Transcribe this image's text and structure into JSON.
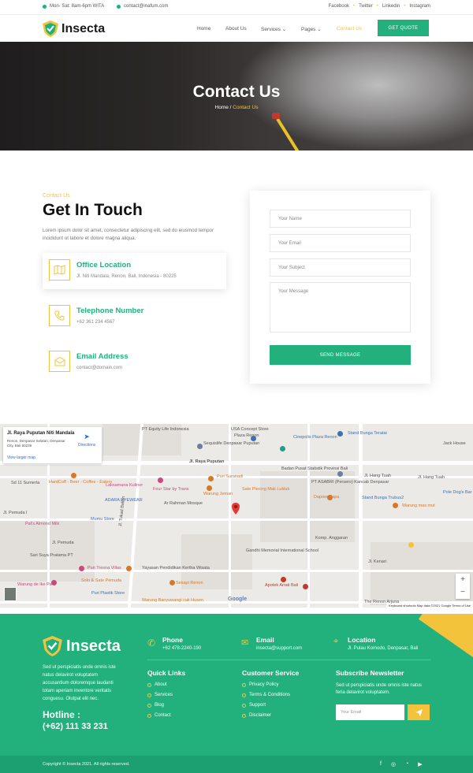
{
  "topbar": {
    "hours": "Mon- Sat: 8am-6pm WITA",
    "email": "contact@inafum.com",
    "social": [
      "Facebook",
      "Twitter",
      "Linkedin",
      "Instagram"
    ]
  },
  "nav": {
    "brand": "Insecta",
    "items": [
      "Home",
      "About Us",
      "Services",
      "Pages",
      "Contact Us"
    ],
    "cta": "GET QUOTE"
  },
  "hero": {
    "title": "Contact Us",
    "crumb_home": "Home /",
    "crumb_current": "Contact Us"
  },
  "contact": {
    "subtitle": "Contact Us",
    "title": "Get In Touch",
    "lead": "Lorem ipsum dolor sit amet, consectetur adipiscing elit, sed do eiusmod tempor incididunt ut labore et dolore magna aliqua.",
    "cards": [
      {
        "title": "Office Location",
        "text": "Jl. Niti Mandala, Renon, Bali, Indonesia - 80225"
      },
      {
        "title": "Telephone Number",
        "text": "+62 361 234 4567"
      },
      {
        "title": "Email Address",
        "text": "contact@domain.com"
      }
    ]
  },
  "form": {
    "name_placeholder": "Your Name",
    "email_placeholder": "Your Email",
    "subject_placeholder": "Your Subject",
    "message_placeholder": "Your Message",
    "submit": "SEND MESSAGE"
  },
  "map": {
    "place_title": "Jl. Raya Puputan Niti Mandala",
    "place_address": "Renon, Denpasar Selatan, Denpasar City, Bali 80239",
    "larger_map": "View larger map",
    "directions": "Directions",
    "labels": [
      "PT Equity Life Indonesia",
      "USA Concept Store",
      "Plaza Renon",
      "Cinepolis Plaza Renon",
      "Stand Bunga Teratai",
      "Jack House",
      "Sequislife Denpasar Puputan",
      "Jl. Raya Puputan",
      "Badan Pusat Statistik Provinsi Bali",
      "Jl. Hang Tuah",
      "Jl. Hang Tuah",
      "PT ASABRI (Persero) Kancab Denpasar",
      "Dapoer Papa",
      "Stand Bunga Trubus2",
      "Warung mas mut",
      "Pole Dog's Bar",
      "HardCoff - Beer - Coffee - Eatery",
      "Laksamana Kuliner",
      "Four Star by Trans",
      "Puri Suranadi",
      "Sate Plecing Mak Lukluk",
      "Warung Jeman",
      "ADARA EYEWEAR",
      "Ar Rahman Mosque",
      "Mumu Store",
      "Pat's Almond Milk",
      "Jl. Pemuda I",
      "Jl. Pemuda",
      "Sari Suya Pratama PT",
      "Puri Tresna Villas",
      "Warung de Ike Pa",
      "Solo & Sate Pemuda",
      "Puri Plastik Store",
      "Yayasan Pendidikan Kertha Wisata",
      "Sekapi Renon",
      "Gandhi Memorial International School",
      "Apotek Arrati Bali",
      "The Renon Arjuna",
      "Warung Banyuwangi cak Husen",
      "Jl. Tukad Balian",
      "Jl. Kenari",
      "Komp. Anggaran",
      "Sd 11 Sumerta"
    ],
    "footer_text": "Keyboard shortcuts   Map data ©2021 Google   Terms of Use",
    "google": "Google"
  },
  "footer": {
    "brand": "Insecta",
    "desc": "Sed ut perspiciatis unde omnis iste natus delavirot voluptatem accusantium doloremque laudanti totam aperiam inventore veritatis conguesu. Olutpat elit nec.",
    "hotline_label": "Hotline :",
    "hotline": "(+62) 111 33 231",
    "phone_title": "Phone",
    "phone": "+62 478-2240-190",
    "email_title": "Email",
    "email": "insecta@support.com",
    "location_title": "Location",
    "location": "Jl. Pulau Komodo, Denpasar, Bali",
    "quick_title": "Quick Links",
    "quick": [
      "About",
      "Services",
      "Blog",
      "Contact"
    ],
    "service_title": "Customer Service",
    "service": [
      "Privacy Policy",
      "Terms & Conditions",
      "Support",
      "Disclaimer"
    ],
    "news_title": "Subscribe Newsletter",
    "news_desc": "Sed ut perspiciatis unde omnis iste natus feria delavirot voluptatem.",
    "news_placeholder": "Your Email",
    "copyright": "Copyright © Insecta 2021. All rights reserved."
  },
  "colors": {
    "accent": "#22b07d",
    "yellow": "#f3c43b"
  }
}
